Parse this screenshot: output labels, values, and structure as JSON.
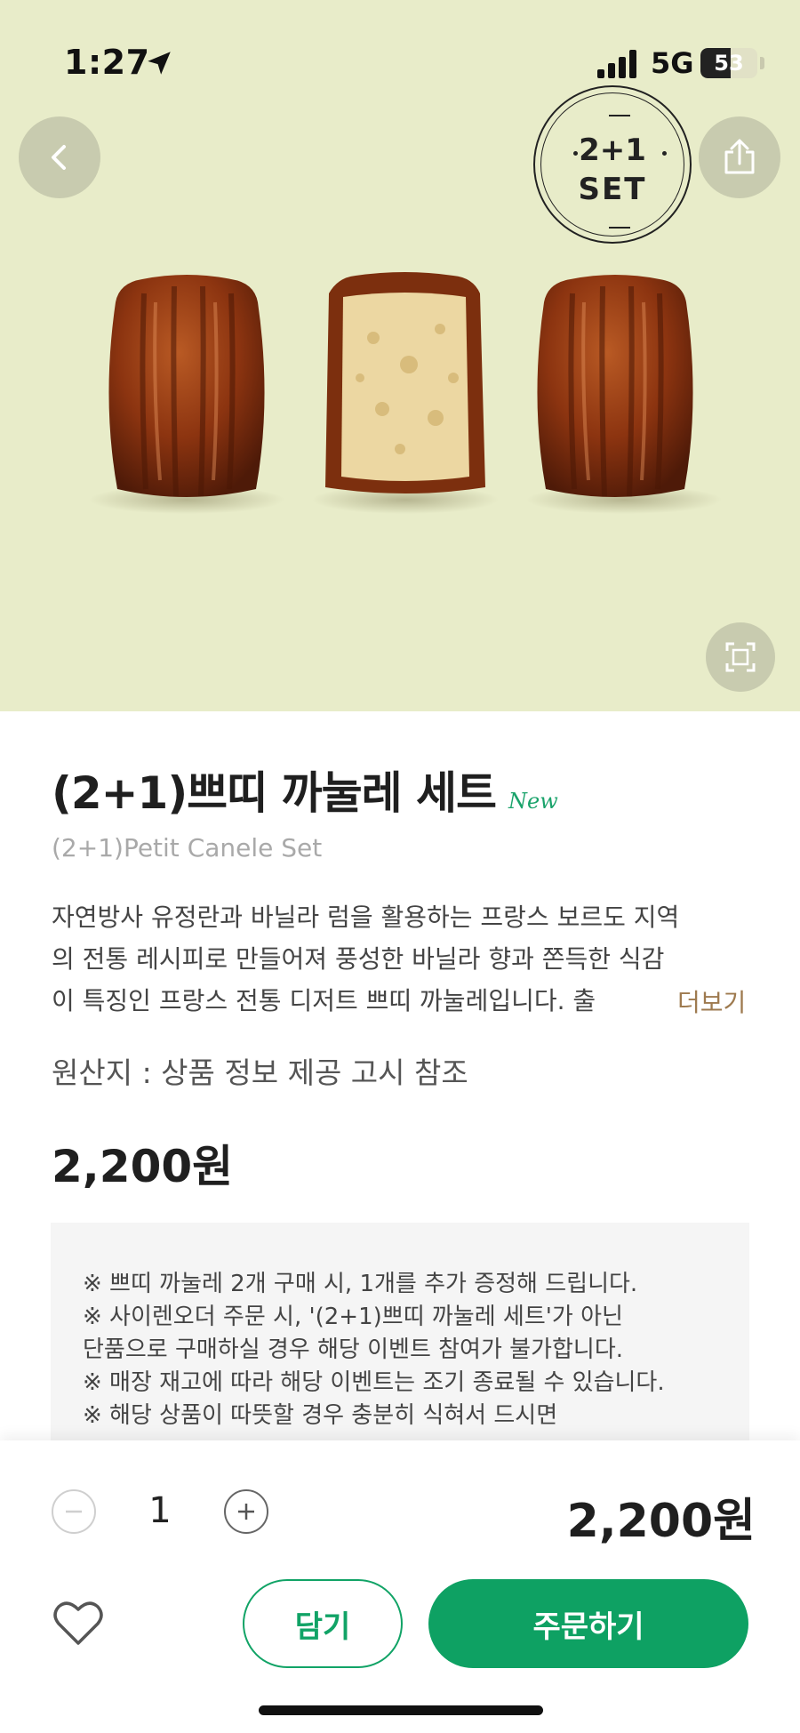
{
  "status_bar": {
    "time": "1:27",
    "network": "5G",
    "battery_percent": 53,
    "battery_label": "53"
  },
  "hero": {
    "background_color": "#e8ecc9",
    "badge_line1": "2+1",
    "badge_line2": "SET",
    "icons": {
      "back": "chevron-left-icon",
      "share": "share-icon",
      "zoom": "expand-icon"
    }
  },
  "product": {
    "title": "(2+1)쁘띠 까눌레 세트",
    "new_badge": "New",
    "subtitle": "(2+1)Petit Canele Set",
    "description_lines": [
      "자연방사 유정란과 바닐라 럼을 활용하는 프랑스 보르도 지역",
      "의 전통 레시피로 만들어져 풍성한 바닐라 향과 쫀득한 식감",
      "이 특징인 프랑스 전통 디저트 쁘띠 까눌레입니다. 출"
    ],
    "more_label": "더보기",
    "origin": "원산지 : 상품 정보 제공 고시 참조",
    "price": "2,200원"
  },
  "notice": {
    "lines": [
      "※ 쁘띠 까눌레 2개 구매 시, 1개를 추가 증정해 드립니다.",
      "※ 사이렌오더 주문 시, '(2+1)쁘띠 까눌레 세트'가 아닌",
      "단품으로 구매하실 경우 해당 이벤트 참여가 불가합니다.",
      "※ 매장 재고에 따라 해당 이벤트는 조기 종료될 수 있습니다.",
      "※ 해당 상품이 따뜻할 경우 충분히 식혀서 드시면"
    ]
  },
  "order_bar": {
    "quantity": "1",
    "total_price": "2,200원",
    "cart_label": "담기",
    "order_label": "주문하기",
    "accent_color": "#0ea163"
  }
}
